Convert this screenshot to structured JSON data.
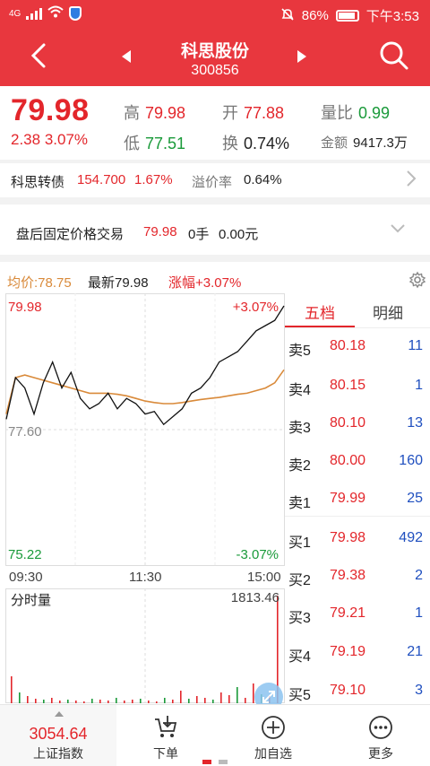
{
  "status_bar": {
    "network": "4G",
    "battery": "86%",
    "time": "下午3:53"
  },
  "header": {
    "title": "科思股份",
    "code": "300856"
  },
  "quote": {
    "price": "79.98",
    "change": "2.38",
    "change_pct": "3.07%",
    "high_label": "高",
    "high": "79.98",
    "open_label": "开",
    "open": "77.88",
    "vol_ratio_label": "量比",
    "vol_ratio": "0.99",
    "low_label": "低",
    "low": "77.51",
    "turnover_label": "换",
    "turnover": "0.74%",
    "amount_label": "金额",
    "amount": "9417.3万"
  },
  "convertible": {
    "name": "科思转债",
    "price": "154.700",
    "pct": "1.67%",
    "premium_label": "溢价率",
    "premium": "0.64%"
  },
  "after_hours": {
    "label": "盘后固定价格交易",
    "price": "79.98",
    "volume": "0手",
    "amount": "0.00元"
  },
  "summary": {
    "avg": "均价:78.75",
    "latest": "最新79.98",
    "change": "涨幅+3.07%"
  },
  "chart": {
    "y_top": "79.98",
    "y_mid": "77.60",
    "y_bottom": "75.22",
    "pct_top": "+3.07%",
    "pct_bottom": "-3.07%",
    "times": [
      "09:30",
      "11:30",
      "15:00"
    ]
  },
  "volume": {
    "title": "分时量",
    "max": "1813.46"
  },
  "book": {
    "tab_active": "五档",
    "tab_other": "明细",
    "asks": [
      {
        "label": "卖5",
        "price": "80.18",
        "vol": "11"
      },
      {
        "label": "卖4",
        "price": "80.15",
        "vol": "1"
      },
      {
        "label": "卖3",
        "price": "80.10",
        "vol": "13"
      },
      {
        "label": "卖2",
        "price": "80.00",
        "vol": "160"
      },
      {
        "label": "卖1",
        "price": "79.99",
        "vol": "25"
      }
    ],
    "bids": [
      {
        "label": "买1",
        "price": "79.98",
        "vol": "492"
      },
      {
        "label": "买2",
        "price": "79.38",
        "vol": "2"
      },
      {
        "label": "买3",
        "price": "79.21",
        "vol": "1"
      },
      {
        "label": "买4",
        "price": "79.19",
        "vol": "21"
      },
      {
        "label": "买5",
        "price": "79.10",
        "vol": "3"
      }
    ]
  },
  "bottom": {
    "index_value": "3054.64",
    "index_label": "上证指数",
    "order": "下单",
    "add": "加自选",
    "more": "更多"
  },
  "colors": {
    "header": "#e8373e",
    "up": "#e3262b",
    "down": "#1a9a3a",
    "avg_line": "#d98a3a"
  },
  "chart_data": {
    "type": "line",
    "title": "",
    "ylim": [
      75.22,
      79.98
    ],
    "x_range": [
      "09:30",
      "15:00"
    ],
    "series": [
      {
        "name": "最新",
        "values": [
          77.8,
          78.6,
          78.4,
          77.9,
          78.5,
          78.9,
          78.4,
          78.7,
          78.2,
          78.0,
          78.1,
          78.3,
          78.0,
          78.2,
          78.1,
          77.9,
          77.95,
          77.7,
          77.85,
          78.0,
          78.3,
          78.4,
          78.6,
          78.9,
          79.0,
          79.1,
          79.3,
          79.5,
          79.6,
          79.7,
          79.98
        ]
      },
      {
        "name": "均价",
        "values": [
          77.9,
          78.6,
          78.65,
          78.6,
          78.55,
          78.5,
          78.45,
          78.4,
          78.35,
          78.3,
          78.3,
          78.3,
          78.28,
          78.25,
          78.2,
          78.15,
          78.12,
          78.1,
          78.1,
          78.12,
          78.15,
          78.18,
          78.2,
          78.22,
          78.25,
          78.28,
          78.3,
          78.35,
          78.4,
          78.5,
          78.75
        ]
      }
    ]
  }
}
